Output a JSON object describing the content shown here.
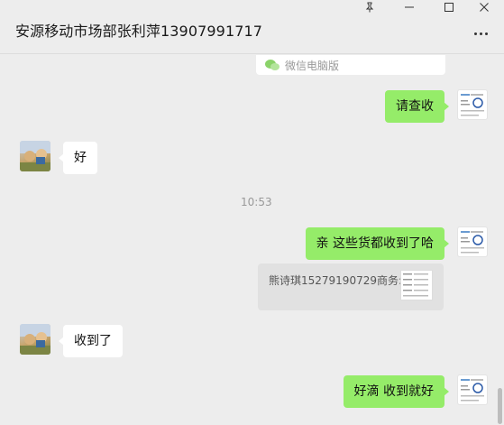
{
  "window": {
    "title": "安源移动市场部张利萍13907991717",
    "pin_icon": "pin-icon",
    "minimize_icon": "minimize-icon",
    "maximize_icon": "maximize-icon",
    "close_icon": "close-icon",
    "more_icon": "more-icon"
  },
  "colors": {
    "my_bubble": "#95ec69",
    "other_bubble": "#ffffff",
    "background": "#ededed"
  },
  "messages": [
    {
      "type": "source_card",
      "text": "微信电脑版"
    },
    {
      "type": "text",
      "from": "me",
      "text": "请查收"
    },
    {
      "type": "text",
      "from": "other",
      "text": "好"
    },
    {
      "type": "time",
      "text": "10:53"
    },
    {
      "type": "text",
      "from": "me",
      "text": "亲 这些货都收到了哈"
    },
    {
      "type": "forward_card",
      "from": "me",
      "text": "熊诗琪15279190729商务:"
    },
    {
      "type": "text",
      "from": "other",
      "text": "收到了"
    },
    {
      "type": "text",
      "from": "me",
      "text": "好滴 收到就好"
    }
  ]
}
